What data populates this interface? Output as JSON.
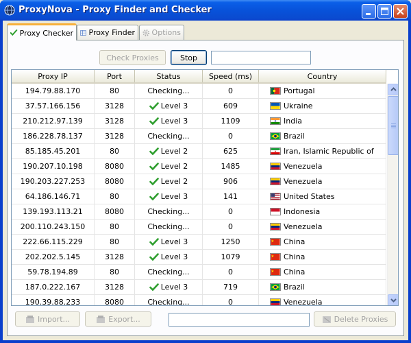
{
  "window": {
    "title": "ProxyNova - Proxy Finder and Checker"
  },
  "tabs": [
    {
      "label": "Proxy Checker",
      "icon": "check-icon",
      "active": true
    },
    {
      "label": "Proxy Finder",
      "icon": "grid-icon",
      "active": false
    },
    {
      "label": "Options",
      "icon": "gear-icon",
      "disabled": true
    }
  ],
  "toolbar": {
    "check_label": "Check Proxies",
    "stop_label": "Stop",
    "status_value": ""
  },
  "table": {
    "headers": [
      "Proxy IP",
      "Port",
      "Status",
      "Speed (ms)",
      "Country"
    ],
    "rows": [
      {
        "ip": "194.79.88.170",
        "port": "80",
        "status": "Checking...",
        "ok": false,
        "speed": "0",
        "country": "Portugal",
        "flag": "pt"
      },
      {
        "ip": "37.57.166.156",
        "port": "3128",
        "status": "Level 3",
        "ok": true,
        "speed": "609",
        "country": "Ukraine",
        "flag": "ua"
      },
      {
        "ip": "210.212.97.139",
        "port": "3128",
        "status": "Level 3",
        "ok": true,
        "speed": "1109",
        "country": "India",
        "flag": "in"
      },
      {
        "ip": "186.228.78.137",
        "port": "3128",
        "status": "Checking...",
        "ok": false,
        "speed": "0",
        "country": "Brazil",
        "flag": "br"
      },
      {
        "ip": "85.185.45.201",
        "port": "80",
        "status": "Level 2",
        "ok": true,
        "speed": "625",
        "country": "Iran, Islamic Republic of",
        "flag": "ir"
      },
      {
        "ip": "190.207.10.198",
        "port": "8080",
        "status": "Level 2",
        "ok": true,
        "speed": "1485",
        "country": "Venezuela",
        "flag": "ve"
      },
      {
        "ip": "190.203.227.253",
        "port": "8080",
        "status": "Level 2",
        "ok": true,
        "speed": "906",
        "country": "Venezuela",
        "flag": "ve"
      },
      {
        "ip": "64.186.146.71",
        "port": "80",
        "status": "Level 3",
        "ok": true,
        "speed": "141",
        "country": "United States",
        "flag": "us"
      },
      {
        "ip": "139.193.113.21",
        "port": "8080",
        "status": "Checking...",
        "ok": false,
        "speed": "0",
        "country": "Indonesia",
        "flag": "id"
      },
      {
        "ip": "200.110.243.150",
        "port": "80",
        "status": "Checking...",
        "ok": false,
        "speed": "0",
        "country": "Venezuela",
        "flag": "ve"
      },
      {
        "ip": "222.66.115.229",
        "port": "80",
        "status": "Level 3",
        "ok": true,
        "speed": "1250",
        "country": "China",
        "flag": "cn"
      },
      {
        "ip": "202.202.5.145",
        "port": "3128",
        "status": "Level 3",
        "ok": true,
        "speed": "1079",
        "country": "China",
        "flag": "cn"
      },
      {
        "ip": "59.78.194.89",
        "port": "80",
        "status": "Checking...",
        "ok": false,
        "speed": "0",
        "country": "China",
        "flag": "cn"
      },
      {
        "ip": "187.0.222.167",
        "port": "3128",
        "status": "Level 3",
        "ok": true,
        "speed": "719",
        "country": "Brazil",
        "flag": "br"
      },
      {
        "ip": "190.39.88.233",
        "port": "8080",
        "status": "Checking...",
        "ok": false,
        "speed": "0",
        "country": "Venezuela",
        "flag": "ve"
      }
    ]
  },
  "bottombar": {
    "import_label": "Import...",
    "export_label": "Export...",
    "delete_label": "Delete Proxies",
    "filter_value": ""
  },
  "colors": {
    "check_green": "#2E9E2E",
    "title_blue": "#0A5FE8",
    "tab_accent": "#F7B03B"
  }
}
